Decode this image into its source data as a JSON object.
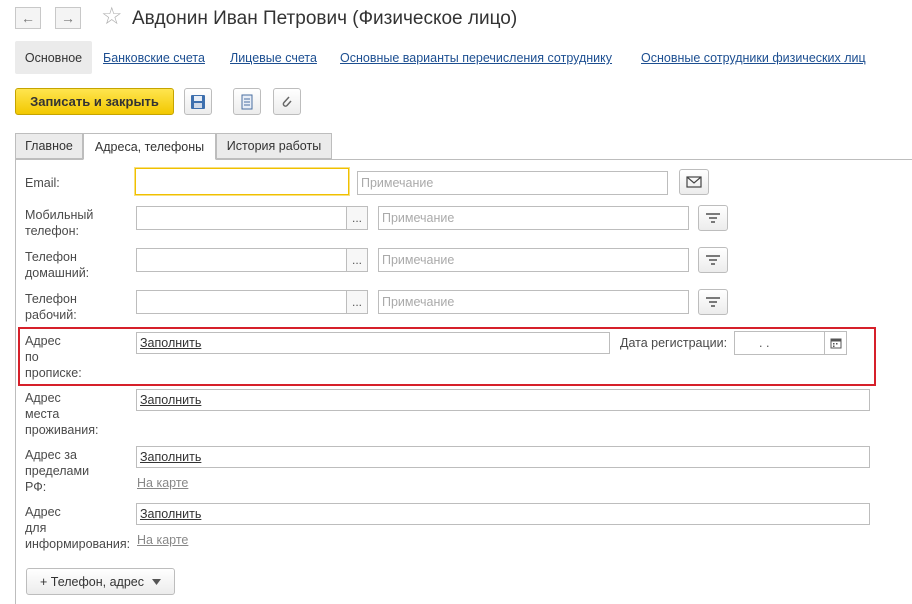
{
  "window": {
    "title": "Авдонин Иван Петрович (Физическое лицо)"
  },
  "nav": {
    "back_icon": "←",
    "forward_icon": "→",
    "favorite_icon": "☆"
  },
  "top_links": [
    "Основное",
    "Банковские счета",
    "Лицевые счета",
    "Основные варианты перечисления сотруднику",
    "Основные сотрудники физических лиц"
  ],
  "toolbar": {
    "save_close_label": "Записать и закрыть"
  },
  "tabs": [
    "Главное",
    "Адреса, телефоны",
    "История работы"
  ],
  "form": {
    "email_label": "Email:",
    "email_note_placeholder": "Примечание",
    "mobile_label_1": "Мобильный",
    "mobile_label_2": "телефон:",
    "mobile_note_placeholder": "Примечание",
    "home_label_1": "Телефон",
    "home_label_2": "домашний:",
    "home_note_placeholder": "Примечание",
    "work_label_1": "Телефон",
    "work_label_2": "рабочий:",
    "work_note_placeholder": "Примечание",
    "dots": "...",
    "reg_label_1": "Адрес",
    "reg_label_2": "по",
    "reg_label_3": "прописке:",
    "reg_fill": "Заполнить",
    "reg_date_label": "Дата регистрации:",
    "reg_date_value": ". .",
    "res_label_1": "Адрес",
    "res_label_2": "места",
    "res_label_3": "проживания:",
    "res_fill": "Заполнить",
    "abroad_label_1": "Адрес за",
    "abroad_label_2": "пределами",
    "abroad_label_3": "РФ:",
    "abroad_fill": "Заполнить",
    "abroad_map": "На карте",
    "info_label_1": "Адрес",
    "info_label_2": "для",
    "info_label_3": "информирования:",
    "info_fill": "Заполнить",
    "info_map": "На карте",
    "add_button": "+ Телефон, адрес"
  },
  "colors": {
    "accent_yellow": "#f2c800",
    "highlight_red": "#d6202a",
    "link_blue": "#1d4f91"
  }
}
